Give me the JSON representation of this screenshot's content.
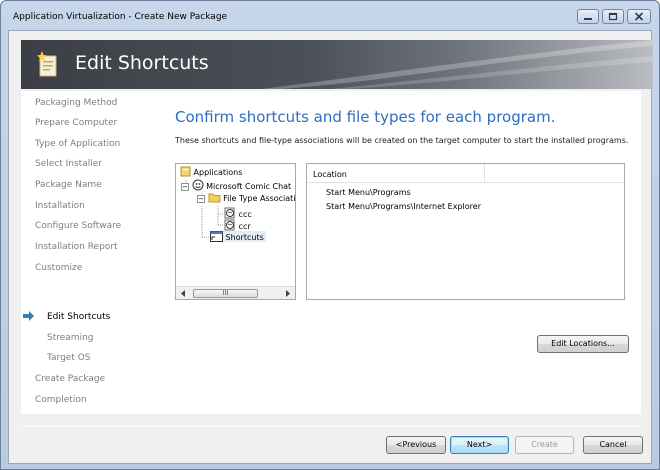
{
  "window": {
    "title": "Application Virtualization - Create New Package",
    "minimize_icon": "minimize-icon",
    "maximize_icon": "maximize-icon",
    "close_icon": "close-icon"
  },
  "banner": {
    "title": "Edit Shortcuts",
    "icon": "wizard-page-icon"
  },
  "nav": {
    "items": [
      {
        "label": "Packaging Method",
        "state": "done"
      },
      {
        "label": "Prepare Computer",
        "state": "done"
      },
      {
        "label": "Type of Application",
        "state": "done"
      },
      {
        "label": "Select Installer",
        "state": "done"
      },
      {
        "label": "Package Name",
        "state": "done"
      },
      {
        "label": "Installation",
        "state": "done"
      },
      {
        "label": "Configure Software",
        "state": "done"
      },
      {
        "label": "Installation Report",
        "state": "done"
      },
      {
        "label": "Customize",
        "state": "done"
      },
      {
        "label": "Edit Shortcuts",
        "state": "current"
      },
      {
        "label": "Streaming",
        "state": "pending"
      },
      {
        "label": "Target OS",
        "state": "pending"
      },
      {
        "label": "Create Package",
        "state": "pending"
      },
      {
        "label": "Completion",
        "state": "pending"
      }
    ],
    "current_marker_icon": "arrow-right-icon"
  },
  "main": {
    "heading": "Confirm shortcuts and file types for each program.",
    "description": "These shortcuts and file-type associations will be created on the target computer to start the installed programs.",
    "tree": {
      "nodes": [
        {
          "label": "Applications",
          "icon": "applications-folder-icon"
        },
        {
          "label": "Microsoft Comic Chat",
          "icon": "application-icon",
          "expander": "−"
        },
        {
          "label": "File Type Associations",
          "icon": "folder-icon",
          "expander": "−"
        },
        {
          "label": "ccc",
          "icon": "file-type-icon"
        },
        {
          "label": "ccr",
          "icon": "file-type-icon"
        },
        {
          "label": "Shortcuts",
          "icon": "shortcut-icon"
        }
      ],
      "scroll_thumb_glyph": "III"
    },
    "list": {
      "column_header": "Location",
      "rows": [
        "Start Menu\\Programs",
        "Start Menu\\Programs\\Internet Explorer"
      ]
    },
    "edit_locations_label": "Edit Locations..."
  },
  "footer": {
    "previous_label": "<Previous",
    "next_label": "Next>",
    "create_label": "Create",
    "cancel_label": "Cancel"
  }
}
